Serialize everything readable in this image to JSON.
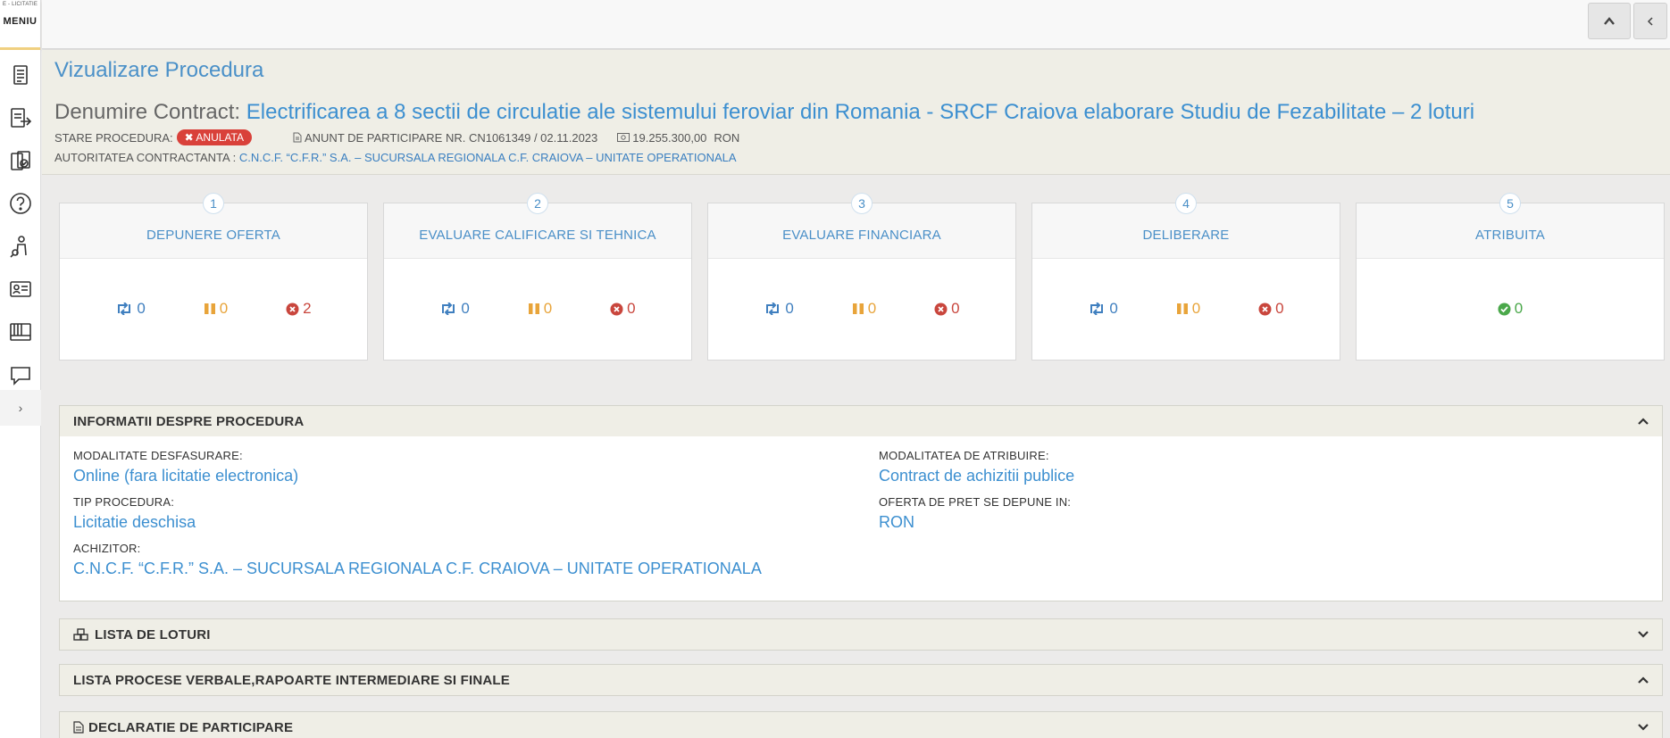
{
  "sidebar": {
    "brand_small": "E - LICITATIE",
    "menu_label": "MENIU",
    "icons": [
      "document-icon",
      "export-icon",
      "certificate-icon",
      "help-icon",
      "person-search-icon",
      "id-card-icon",
      "archive-icon",
      "chat-icon"
    ],
    "expand_label": "›"
  },
  "topbar": {
    "up_icon": "chevron-up-icon",
    "back_icon": "chevron-left-icon"
  },
  "header": {
    "page_title": "Vizualizare Procedura",
    "contract_label": "Denumire Contract:",
    "contract_name": "Electrificarea a 8 sectii de circulatie ale sistemului feroviar din Romania - SRCF Craiova elaborare Studiu de Fezabilitate – 2 loturi",
    "status_label": "STARE PROCEDURA:",
    "status_value": "ANULATA",
    "notice": "ANUNT DE PARTICIPARE NR. CN1061349 / 02.11.2023",
    "amount": "19.255.300,00",
    "currency": "RON",
    "authority_label": "AUTORITATEA CONTRACTANTA :",
    "authority_name": "C.N.C.F. “C.F.R.” S.A. – SUCURSALA REGIONALA C.F. CRAIOVA – UNITATE OPERATIONALA"
  },
  "colors": {
    "accent": "#3c8fd0",
    "danger": "#d9413a",
    "warning": "#e8a43a",
    "success": "#4aa84a"
  },
  "stages": [
    {
      "num": "1",
      "title": "DEPUNERE OFERTA",
      "cycle": "0",
      "pause": "0",
      "x": "2"
    },
    {
      "num": "2",
      "title": "EVALUARE CALIFICARE SI TEHNICA",
      "cycle": "0",
      "pause": "0",
      "x": "0"
    },
    {
      "num": "3",
      "title": "EVALUARE FINANCIARA",
      "cycle": "0",
      "pause": "0",
      "x": "0"
    },
    {
      "num": "4",
      "title": "DELIBERARE",
      "cycle": "0",
      "pause": "0",
      "x": "0"
    },
    {
      "num": "5",
      "title": "ATRIBUITA",
      "ok": "0"
    }
  ],
  "info_panel": {
    "title": "INFORMATII DESPRE PROCEDURA",
    "modalitate_label": "MODALITATE DESFASURARE:",
    "modalitate_value": "Online (fara licitatie electronica)",
    "atribuire_label": "MODALITATEA DE ATRIBUIRE:",
    "atribuire_value": "Contract de achizitii publice",
    "tip_label": "TIP PROCEDURA:",
    "tip_value": "Licitatie deschisa",
    "oferta_label": "OFERTA DE PRET SE DEPUNE IN:",
    "oferta_value": "RON",
    "achizitor_label": "ACHIZITOR:",
    "achizitor_value": "C.N.C.F. “C.F.R.” S.A. – SUCURSALA REGIONALA C.F. CRAIOVA – UNITATE OPERATIONALA"
  },
  "panels": {
    "loturi": "LISTA DE LOTURI",
    "procese": "LISTA PROCESE VERBALE,RAPOARTE INTERMEDIARE SI FINALE",
    "declaratie": "DECLARATIE DE PARTICIPARE"
  }
}
